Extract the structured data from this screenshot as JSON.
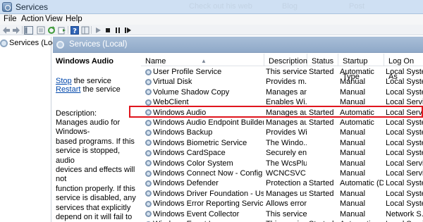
{
  "window": {
    "title": "Services",
    "ghost_tabs": [
      "Check out his web",
      "Blog",
      "Post"
    ]
  },
  "menu": [
    "File",
    "Action",
    "View",
    "Help"
  ],
  "toolbar_icons": [
    "back-icon",
    "forward-icon",
    "show-hide-tree-icon",
    "properties-icon",
    "refresh-icon",
    "export-icon",
    "help-icon",
    "view-icon",
    "play-icon",
    "stop-icon",
    "pause-icon",
    "resume-icon"
  ],
  "tree": {
    "root_label": "Services (Local)"
  },
  "panel": {
    "title": "Services (Local)"
  },
  "details": {
    "service_name": "Windows Audio",
    "stop_link": "Stop",
    "stop_suffix": " the service",
    "restart_link": "Restart",
    "restart_suffix": " the service",
    "description_label": "Description:",
    "description_lines": [
      "Manages audio for Windows-",
      "based programs.  If this",
      "service is stopped, audio",
      "devices and effects will not",
      "function properly.  If this",
      "service is disabled, any",
      "services that explicitly",
      "depend on it will fail to start"
    ]
  },
  "table": {
    "columns": [
      "Name",
      "Description",
      "Status",
      "Startup Type",
      "Log On As"
    ],
    "rows": [
      {
        "name": "User Profile Service",
        "description": "This service ...",
        "status": "Started",
        "startup": "Automatic",
        "logon": "Local Syste"
      },
      {
        "name": "Virtual Disk",
        "description": "Provides m...",
        "status": "",
        "startup": "Manual",
        "logon": "Local Syste"
      },
      {
        "name": "Volume Shadow Copy",
        "description": "Manages an...",
        "status": "",
        "startup": "Manual",
        "logon": "Local Syste"
      },
      {
        "name": "WebClient",
        "description": "Enables Wi...",
        "status": "",
        "startup": "Manual",
        "logon": "Local Servi"
      },
      {
        "name": "Windows Audio",
        "description": "Manages au...",
        "status": "Started",
        "startup": "Automatic",
        "logon": "Local Servi"
      },
      {
        "name": "Windows Audio Endpoint Builder",
        "description": "Manages au...",
        "status": "Started",
        "startup": "Automatic",
        "logon": "Local Syste"
      },
      {
        "name": "Windows Backup",
        "description": "Provides Wi...",
        "status": "",
        "startup": "Manual",
        "logon": "Local Syste"
      },
      {
        "name": "Windows Biometric Service",
        "description": "The Windo...",
        "status": "",
        "startup": "Manual",
        "logon": "Local Syste"
      },
      {
        "name": "Windows CardSpace",
        "description": "Securely en...",
        "status": "",
        "startup": "Manual",
        "logon": "Local Syste"
      },
      {
        "name": "Windows Color System",
        "description": "The WcsPlu...",
        "status": "",
        "startup": "Manual",
        "logon": "Local Servi"
      },
      {
        "name": "Windows Connect Now - Config Regis...",
        "description": "WCNCSVC ...",
        "status": "",
        "startup": "Manual",
        "logon": "Local Servi"
      },
      {
        "name": "Windows Defender",
        "description": "Protection a...",
        "status": "Started",
        "startup": "Automatic (D...",
        "logon": "Local Syste"
      },
      {
        "name": "Windows Driver Foundation - User-m...",
        "description": "Manages us...",
        "status": "Started",
        "startup": "Manual",
        "logon": "Local Syste"
      },
      {
        "name": "Windows Error Reporting Service",
        "description": "Allows error...",
        "status": "",
        "startup": "Manual",
        "logon": "Local Syste"
      },
      {
        "name": "Windows Event Collector",
        "description": "This service ...",
        "status": "",
        "startup": "Manual",
        "logon": "Network S..."
      },
      {
        "name": "Windows Event Log",
        "description": "This service ...",
        "status": "Started",
        "startup": "Automatic",
        "logon": "Local Servi"
      }
    ]
  },
  "colors": {
    "highlight": "#e0151d",
    "header_blue": "#9bb4d2",
    "link": "#0047ab"
  }
}
